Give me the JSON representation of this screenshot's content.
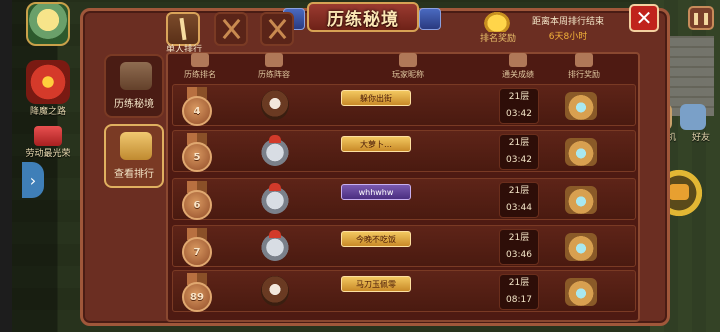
{
  "panel": {
    "title": "历练秘境",
    "reward_label": "排名奖励",
    "countdown_label": "距离本周排行结束",
    "countdown_value": "6天8小时"
  },
  "tabs": {
    "sub_tab_label": "单人排行"
  },
  "side_menu": {
    "items": [
      {
        "label": "历练秘境",
        "active": false
      },
      {
        "label": "查看排行",
        "active": true
      }
    ]
  },
  "table": {
    "headers": [
      "历练排名",
      "历练阵容",
      "玩家昵称",
      "通关成绩",
      "排行奖励"
    ],
    "rows": [
      {
        "rank": "4",
        "hero": "brown",
        "name": "躲你出街",
        "plate": "gold",
        "floor": "21层",
        "time": "03:42"
      },
      {
        "rank": "5",
        "hero": "knight",
        "name": "大萝卜…",
        "plate": "gold",
        "floor": "21层",
        "time": "03:42"
      },
      {
        "rank": "6",
        "hero": "knight",
        "name": "whhwhw",
        "plate": "purple",
        "floor": "21层",
        "time": "03:44"
      },
      {
        "rank": "7",
        "hero": "knight",
        "name": "今晚不吃饭",
        "plate": "gold",
        "floor": "21层",
        "time": "03:46"
      },
      {
        "rank": "89",
        "hero": "brown",
        "name": "马刀玉佩零",
        "plate": "gold",
        "floor": "21层",
        "time": "08:17"
      }
    ]
  },
  "hud_left": {
    "labels": [
      "降魔之路",
      "劳动最光荣"
    ]
  },
  "hud_right": {
    "labels": [
      "联机",
      "好友"
    ]
  },
  "colors": {
    "panel_bg": "#6b2e22",
    "accent_gold": "#e0b060",
    "close_red": "#c0231c"
  }
}
